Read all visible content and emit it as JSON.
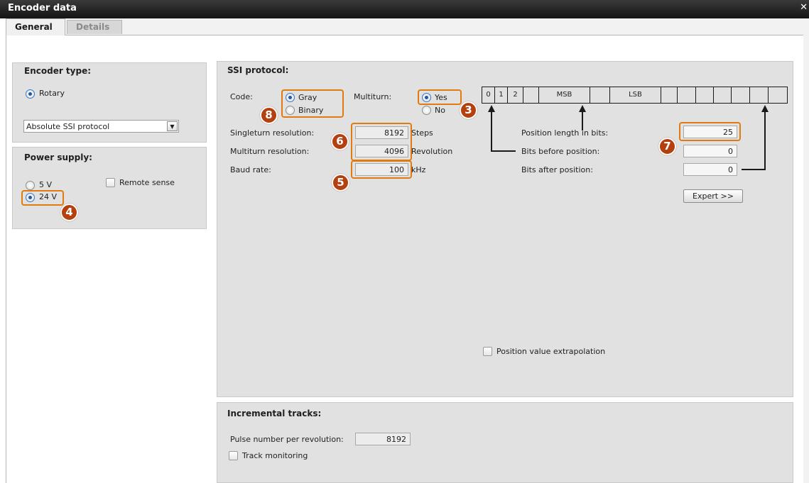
{
  "window": {
    "title": "Encoder data"
  },
  "tabs": [
    {
      "label": "General"
    },
    {
      "label": "Details"
    }
  ],
  "encoder_type": {
    "title": "Encoder type:",
    "option": "Rotary",
    "protocol_select": "Absolute SSI protocol"
  },
  "power_supply": {
    "title": "Power supply:",
    "option_5v": "5 V",
    "option_24v": "24 V",
    "selected": "24 V",
    "remote_sense": "Remote sense"
  },
  "ssi": {
    "title": "SSI protocol:",
    "code_label": "Code:",
    "code_gray": "Gray",
    "code_binary": "Binary",
    "code_selected": "Gray",
    "multiturn_label": "Multiturn:",
    "multiturn_yes": "Yes",
    "multiturn_no": "No",
    "multiturn_selected": "Yes",
    "singleturn_label": "Singleturn resolution:",
    "singleturn_value": "8192",
    "singleturn_unit": "Steps",
    "multiturn_res_label": "Multiturn resolution:",
    "multiturn_res_value": "4096",
    "multiturn_res_unit": "Revolution",
    "baud_label": "Baud rate:",
    "baud_value": "100",
    "baud_unit": "kHz",
    "bits": [
      "0",
      "1",
      "2",
      "",
      "MSB",
      "",
      "LSB",
      "",
      "",
      "",
      "",
      "",
      "",
      ""
    ],
    "pos_length_label": "Position length in bits:",
    "pos_length_value": "25",
    "bits_before_label": "Bits before position:",
    "bits_before_value": "0",
    "bits_after_label": "Bits after position:",
    "bits_after_value": "0",
    "expert_button": "Expert >>",
    "extrapolation_label": "Position value extrapolation"
  },
  "incremental": {
    "title": "Incremental tracks:",
    "pulse_label": "Pulse number per revolution:",
    "pulse_value": "8192",
    "track_monitoring": "Track monitoring"
  },
  "callouts": [
    "3",
    "4",
    "5",
    "6",
    "7",
    "8"
  ],
  "colors": {
    "highlight": "#e07b10",
    "badge": "#b4400f",
    "panel": "#e1e1e1"
  }
}
